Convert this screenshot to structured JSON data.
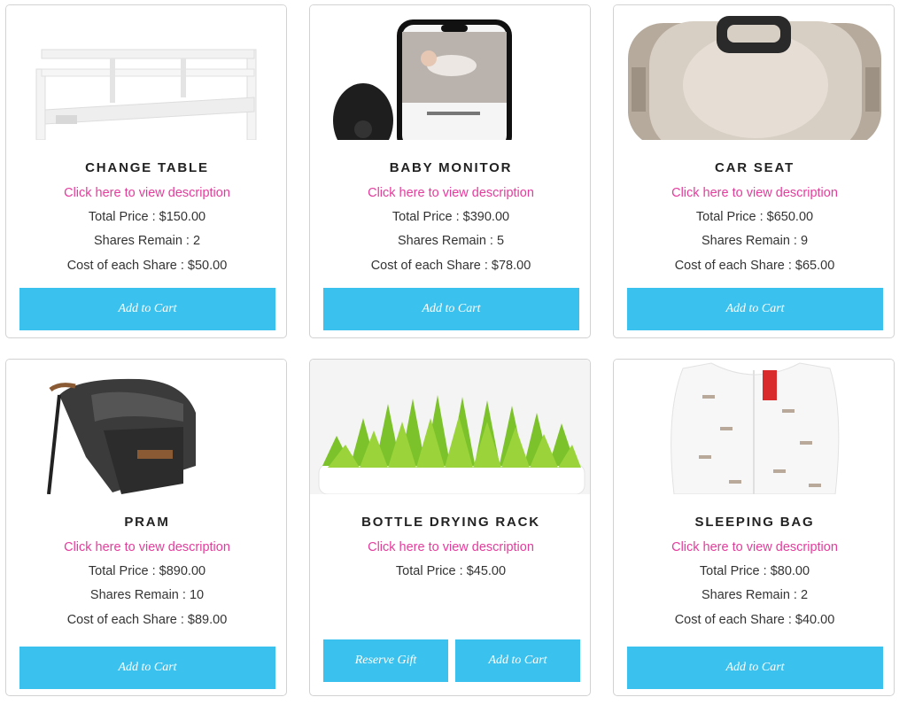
{
  "desc_link": "Click here to view description",
  "products": [
    {
      "name": "CHANGE TABLE",
      "total_price": "Total Price : $150.00",
      "shares_remain": "Shares Remain : 2",
      "share_cost": "Cost of each Share : $50.00",
      "add_label": "Add to Cart"
    },
    {
      "name": "BABY MONITOR",
      "total_price": "Total Price : $390.00",
      "shares_remain": "Shares Remain : 5",
      "share_cost": "Cost of each Share : $78.00",
      "add_label": "Add to Cart"
    },
    {
      "name": "CAR SEAT",
      "total_price": "Total Price : $650.00",
      "shares_remain": "Shares Remain : 9",
      "share_cost": "Cost of each Share : $65.00",
      "add_label": "Add to Cart"
    },
    {
      "name": "PRAM",
      "total_price": "Total Price : $890.00",
      "shares_remain": "Shares Remain : 10",
      "share_cost": "Cost of each Share : $89.00",
      "add_label": "Add to Cart"
    },
    {
      "name": "BOTTLE DRYING RACK",
      "total_price": "Total Price : $45.00",
      "reserve_label": "Reserve Gift",
      "add_label": "Add to Cart"
    },
    {
      "name": "SLEEPING BAG",
      "total_price": "Total Price : $80.00",
      "shares_remain": "Shares Remain : 2",
      "share_cost": "Cost of each Share : $40.00",
      "add_label": "Add to Cart"
    }
  ],
  "colors": {
    "accent_button": "#3ac1ee",
    "link": "#e43c9c",
    "text": "#333333"
  }
}
